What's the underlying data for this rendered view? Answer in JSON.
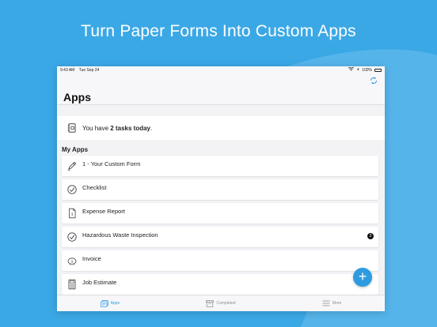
{
  "headline": "Turn Paper Forms Into Custom Apps",
  "statusbar": {
    "time": "9:43 AM",
    "date": "Tue Sep 24",
    "battery": "100%"
  },
  "navbar": {
    "title": "Apps"
  },
  "tasks": {
    "prefix": "You have ",
    "count_text": "2 tasks today",
    "suffix": "."
  },
  "section_title": "My Apps",
  "apps": [
    {
      "label": "1 - Your Custom Form",
      "icon": "pencil-icon"
    },
    {
      "label": "Checklist",
      "icon": "checkmark-circle-icon"
    },
    {
      "label": "Expense Report",
      "icon": "dollar-document-icon"
    },
    {
      "label": "Hazardous Waste Inspection",
      "icon": "checkmark-circle-icon",
      "badge": "2"
    },
    {
      "label": "Invoice",
      "icon": "piggy-bank-icon"
    },
    {
      "label": "Job Estimate",
      "icon": "calculator-icon"
    }
  ],
  "fab_label": "+",
  "tabs": [
    {
      "label": "Apps",
      "icon": "apps-icon",
      "active": true
    },
    {
      "label": "Completed",
      "icon": "archive-box-icon",
      "active": false
    },
    {
      "label": "More",
      "icon": "menu-lines-icon",
      "active": false
    }
  ],
  "colors": {
    "background": "#3ba8e6",
    "accent": "#2e9be0"
  }
}
